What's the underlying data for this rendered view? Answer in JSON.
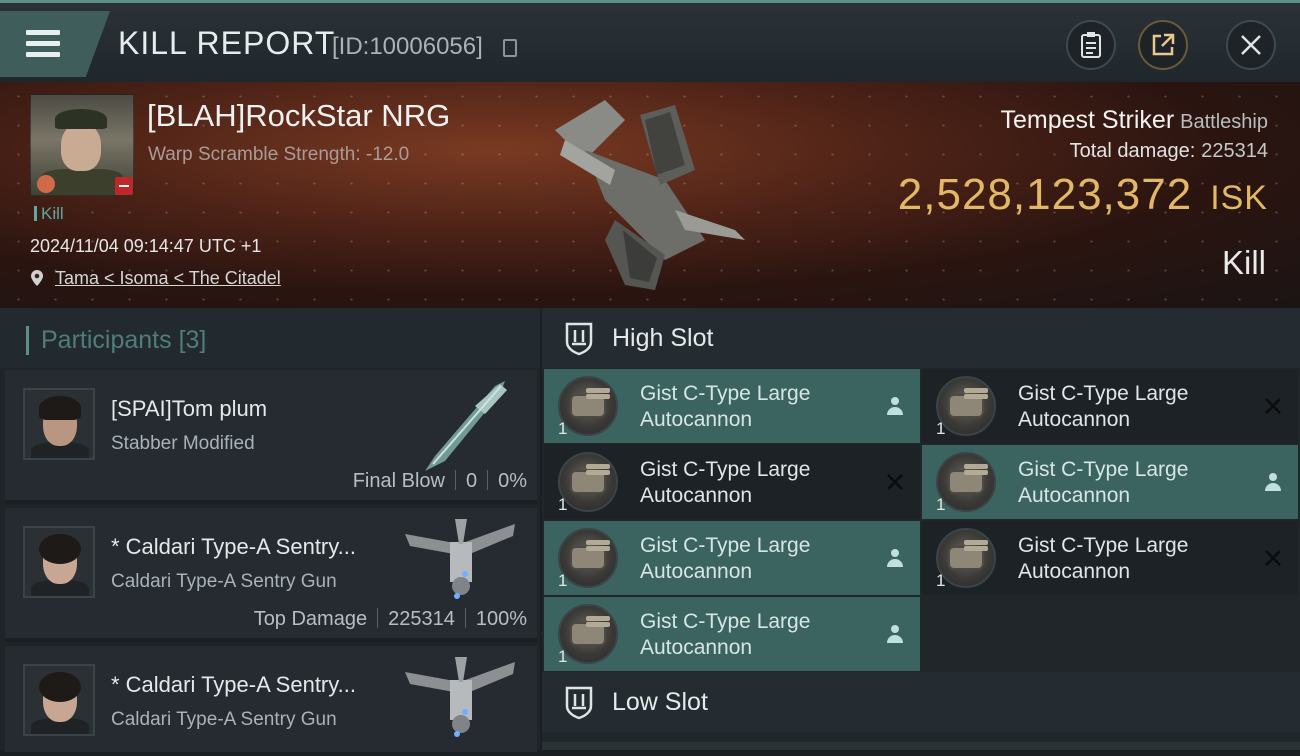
{
  "header": {
    "title": "KILL REPORT",
    "report_id": "[ID:10006056]"
  },
  "victim": {
    "name": "[BLAH]RockStar NRG",
    "warp_scramble": "Warp Scramble Strength: -12.0",
    "kill_tag": "Kill",
    "datetime": "2024/11/04 09:14:47 UTC +1",
    "location": "Tama < Isoma < The Citadel",
    "ship_name": "Tempest Striker",
    "ship_class": "Battleship",
    "damage_label": "Total damage:",
    "damage_value": "225314",
    "isk_value": "2,528,123,372",
    "isk_unit": "ISK",
    "result": "Kill"
  },
  "participants": {
    "label": "Participants",
    "count": "[3]",
    "items": [
      {
        "name": "[SPAI]Tom plum",
        "ship": "Stabber Modified",
        "role": "Final Blow",
        "damage": "0",
        "percent": "0%"
      },
      {
        "name": "* Caldari Type-A Sentry...",
        "ship": "Caldari Type-A Sentry Gun",
        "role": "Top Damage",
        "damage": "225314",
        "percent": "100%"
      },
      {
        "name": "* Caldari Type-A Sentry...",
        "ship": "Caldari Type-A Sentry Gun"
      }
    ]
  },
  "slots": {
    "high_label": "High Slot",
    "low_label": "Low Slot",
    "high_modules": [
      {
        "name": "Gist C-Type Large Autocannon",
        "qty": "1",
        "status": "dropped"
      },
      {
        "name": "Gist C-Type Large Autocannon",
        "qty": "1",
        "status": "destroyed"
      },
      {
        "name": "Gist C-Type Large Autocannon",
        "qty": "1",
        "status": "destroyed"
      },
      {
        "name": "Gist C-Type Large Autocannon",
        "qty": "1",
        "status": "dropped"
      },
      {
        "name": "Gist C-Type Large Autocannon",
        "qty": "1",
        "status": "dropped"
      },
      {
        "name": "Gist C-Type Large Autocannon",
        "qty": "1",
        "status": "destroyed"
      },
      {
        "name": "Gist C-Type Large Autocannon",
        "qty": "1",
        "status": "dropped"
      }
    ]
  },
  "colors": {
    "accent": "#5b8f88",
    "isk": "#e2b765",
    "dropped_bg": "#3b6360",
    "destroyed_bg": "#1c2226"
  },
  "icons": {
    "menu": "hamburger-icon",
    "clipboard": "clipboard-icon",
    "share": "share-icon",
    "close": "close-icon",
    "location": "map-pin-icon",
    "slot": "slot-shield-icon",
    "dropped": "person-icon",
    "destroyed": "x-icon"
  }
}
